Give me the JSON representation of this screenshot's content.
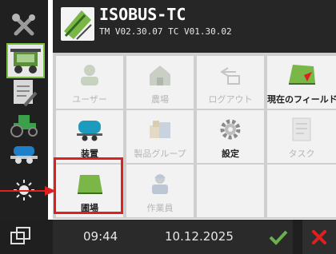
{
  "header": {
    "title": "ISOBUS-TC",
    "version": "TM V02.30.07 TC V01.30.02",
    "logo_icon": "field-logo-icon"
  },
  "sidebar": {
    "items": [
      {
        "icon": "tools-icon"
      },
      {
        "icon": "tractor-cab-icon"
      },
      {
        "icon": "notepad-icon"
      },
      {
        "icon": "tractor-icon"
      },
      {
        "icon": "trailer-icon"
      },
      {
        "icon": "brightness-icon"
      },
      {
        "icon": "screen-switch-icon"
      }
    ]
  },
  "tiles": [
    {
      "label": "ユーザー",
      "enabled": false,
      "icon": "user-icon"
    },
    {
      "label": "農場",
      "enabled": false,
      "icon": "farm-icon"
    },
    {
      "label": "ログアウト",
      "enabled": false,
      "icon": "logout-icon"
    },
    {
      "label": "現在のフィールド",
      "enabled": true,
      "icon": "current-field-icon"
    },
    {
      "label": "装置",
      "enabled": true,
      "icon": "device-icon"
    },
    {
      "label": "製品グループ",
      "enabled": false,
      "icon": "product-group-icon"
    },
    {
      "label": "設定",
      "enabled": true,
      "icon": "settings-icon"
    },
    {
      "label": "タスク",
      "enabled": false,
      "icon": "task-icon"
    },
    {
      "label": "圃場",
      "enabled": true,
      "icon": "field-icon"
    },
    {
      "label": "作業員",
      "enabled": false,
      "icon": "worker-icon"
    }
  ],
  "footer": {
    "time": "09:44",
    "date": "10.12.2025"
  },
  "colors": {
    "highlight": "#e01f1f",
    "accent_green": "#6ab04c",
    "cancel_red": "#e02020"
  }
}
